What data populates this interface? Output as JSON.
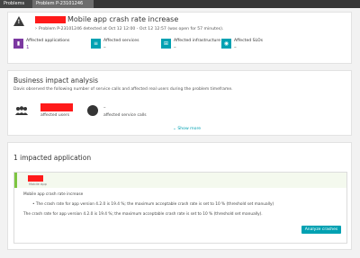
{
  "breadcrumb": {
    "items": [
      "Problems",
      "Problem P-23101246"
    ]
  },
  "problem": {
    "title": "Mobile app crash rate increase",
    "subline": "Problem P-23101246 detected at Oct 12 12:00 - Oct 12 12:57 (was open for 57 minutes).",
    "tiles": [
      {
        "label": "Affected applications",
        "value": "1",
        "icon": "applications-icon",
        "color": "#7c38a1"
      },
      {
        "label": "Affected services",
        "value": "–",
        "icon": "services-icon",
        "color": "#00a1b2"
      },
      {
        "label": "Affected infrastructure",
        "value": "–",
        "icon": "infrastructure-icon",
        "color": "#00a1b2"
      },
      {
        "label": "Affected SLOs",
        "value": "–",
        "icon": "slo-icon",
        "color": "#00a1b2"
      }
    ]
  },
  "impact": {
    "title": "Business impact analysis",
    "description": "Davis observed the following number of service calls and affected real users during the problem timeframe.",
    "affected_users_label": "affected users",
    "service_calls_value": "–",
    "service_calls_label": "affected service calls",
    "show_more": "Show more"
  },
  "apps": {
    "title": "1 impacted application",
    "app_type": "Mobile App",
    "event_title": "Mobile app crash rate increase",
    "bullet": "The crash rate for app version 4.2.0 is 19.4 %; the maximum acceptable crash rate is set to 10 % (threshold set manually)",
    "detail": "The crash rate for app version 4.2.0 is 19.4 %; the maximum acceptable crash rate is set to 10 % (threshold set manually).",
    "analyze_button": "Analyze crashes"
  }
}
